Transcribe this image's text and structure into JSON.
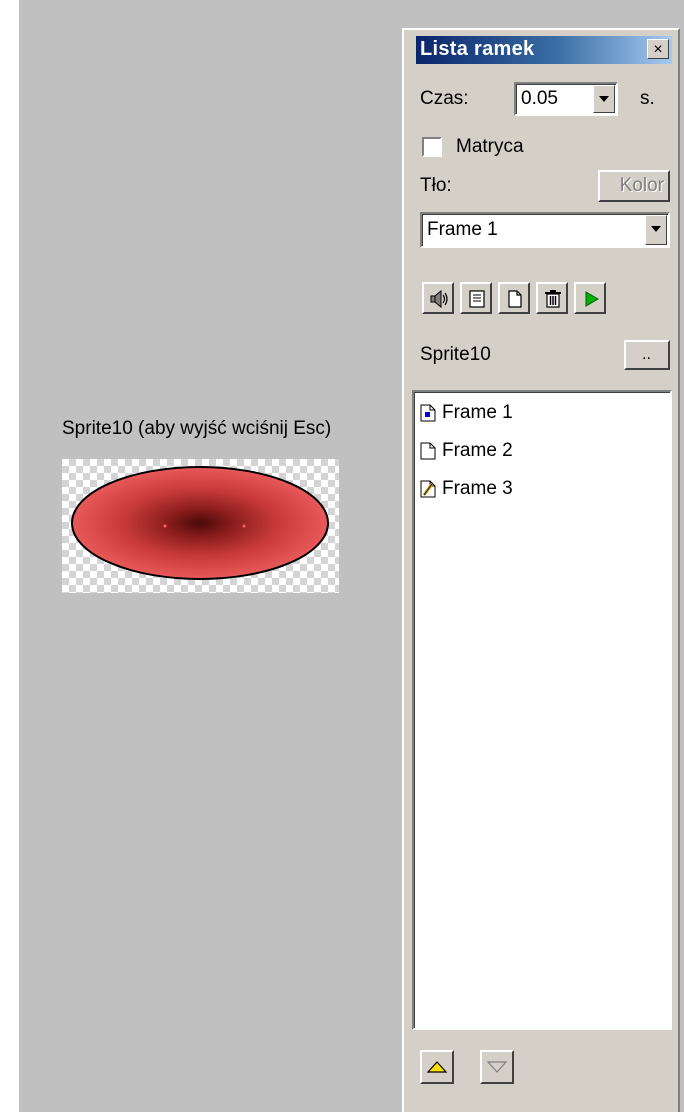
{
  "sprite": {
    "caption": "Sprite10 (aby wyjść wciśnij Esc)"
  },
  "panel": {
    "title": "Lista ramek",
    "close_glyph": "×",
    "time_label": "Czas:",
    "time_value": "0.05",
    "time_unit": "s.",
    "matrix_label": "Matryca",
    "matrix_checked": false,
    "background_label": "Tło:",
    "color_button_label": "Kolor",
    "frame_select_value": "Frame 1",
    "toolbar_icons": [
      "sound-icon",
      "properties-icon",
      "new-frame-icon",
      "delete-icon",
      "play-icon"
    ],
    "sprite_name": "Sprite10",
    "browse_button_label": "..",
    "frames": [
      {
        "label": "Frame 1",
        "icon": "frame-current-icon"
      },
      {
        "label": "Frame 2",
        "icon": "frame-page-icon"
      },
      {
        "label": "Frame 3",
        "icon": "frame-edit-icon"
      }
    ],
    "move_up_icon": "move-up-icon",
    "move_down_icon": "move-down-icon"
  }
}
